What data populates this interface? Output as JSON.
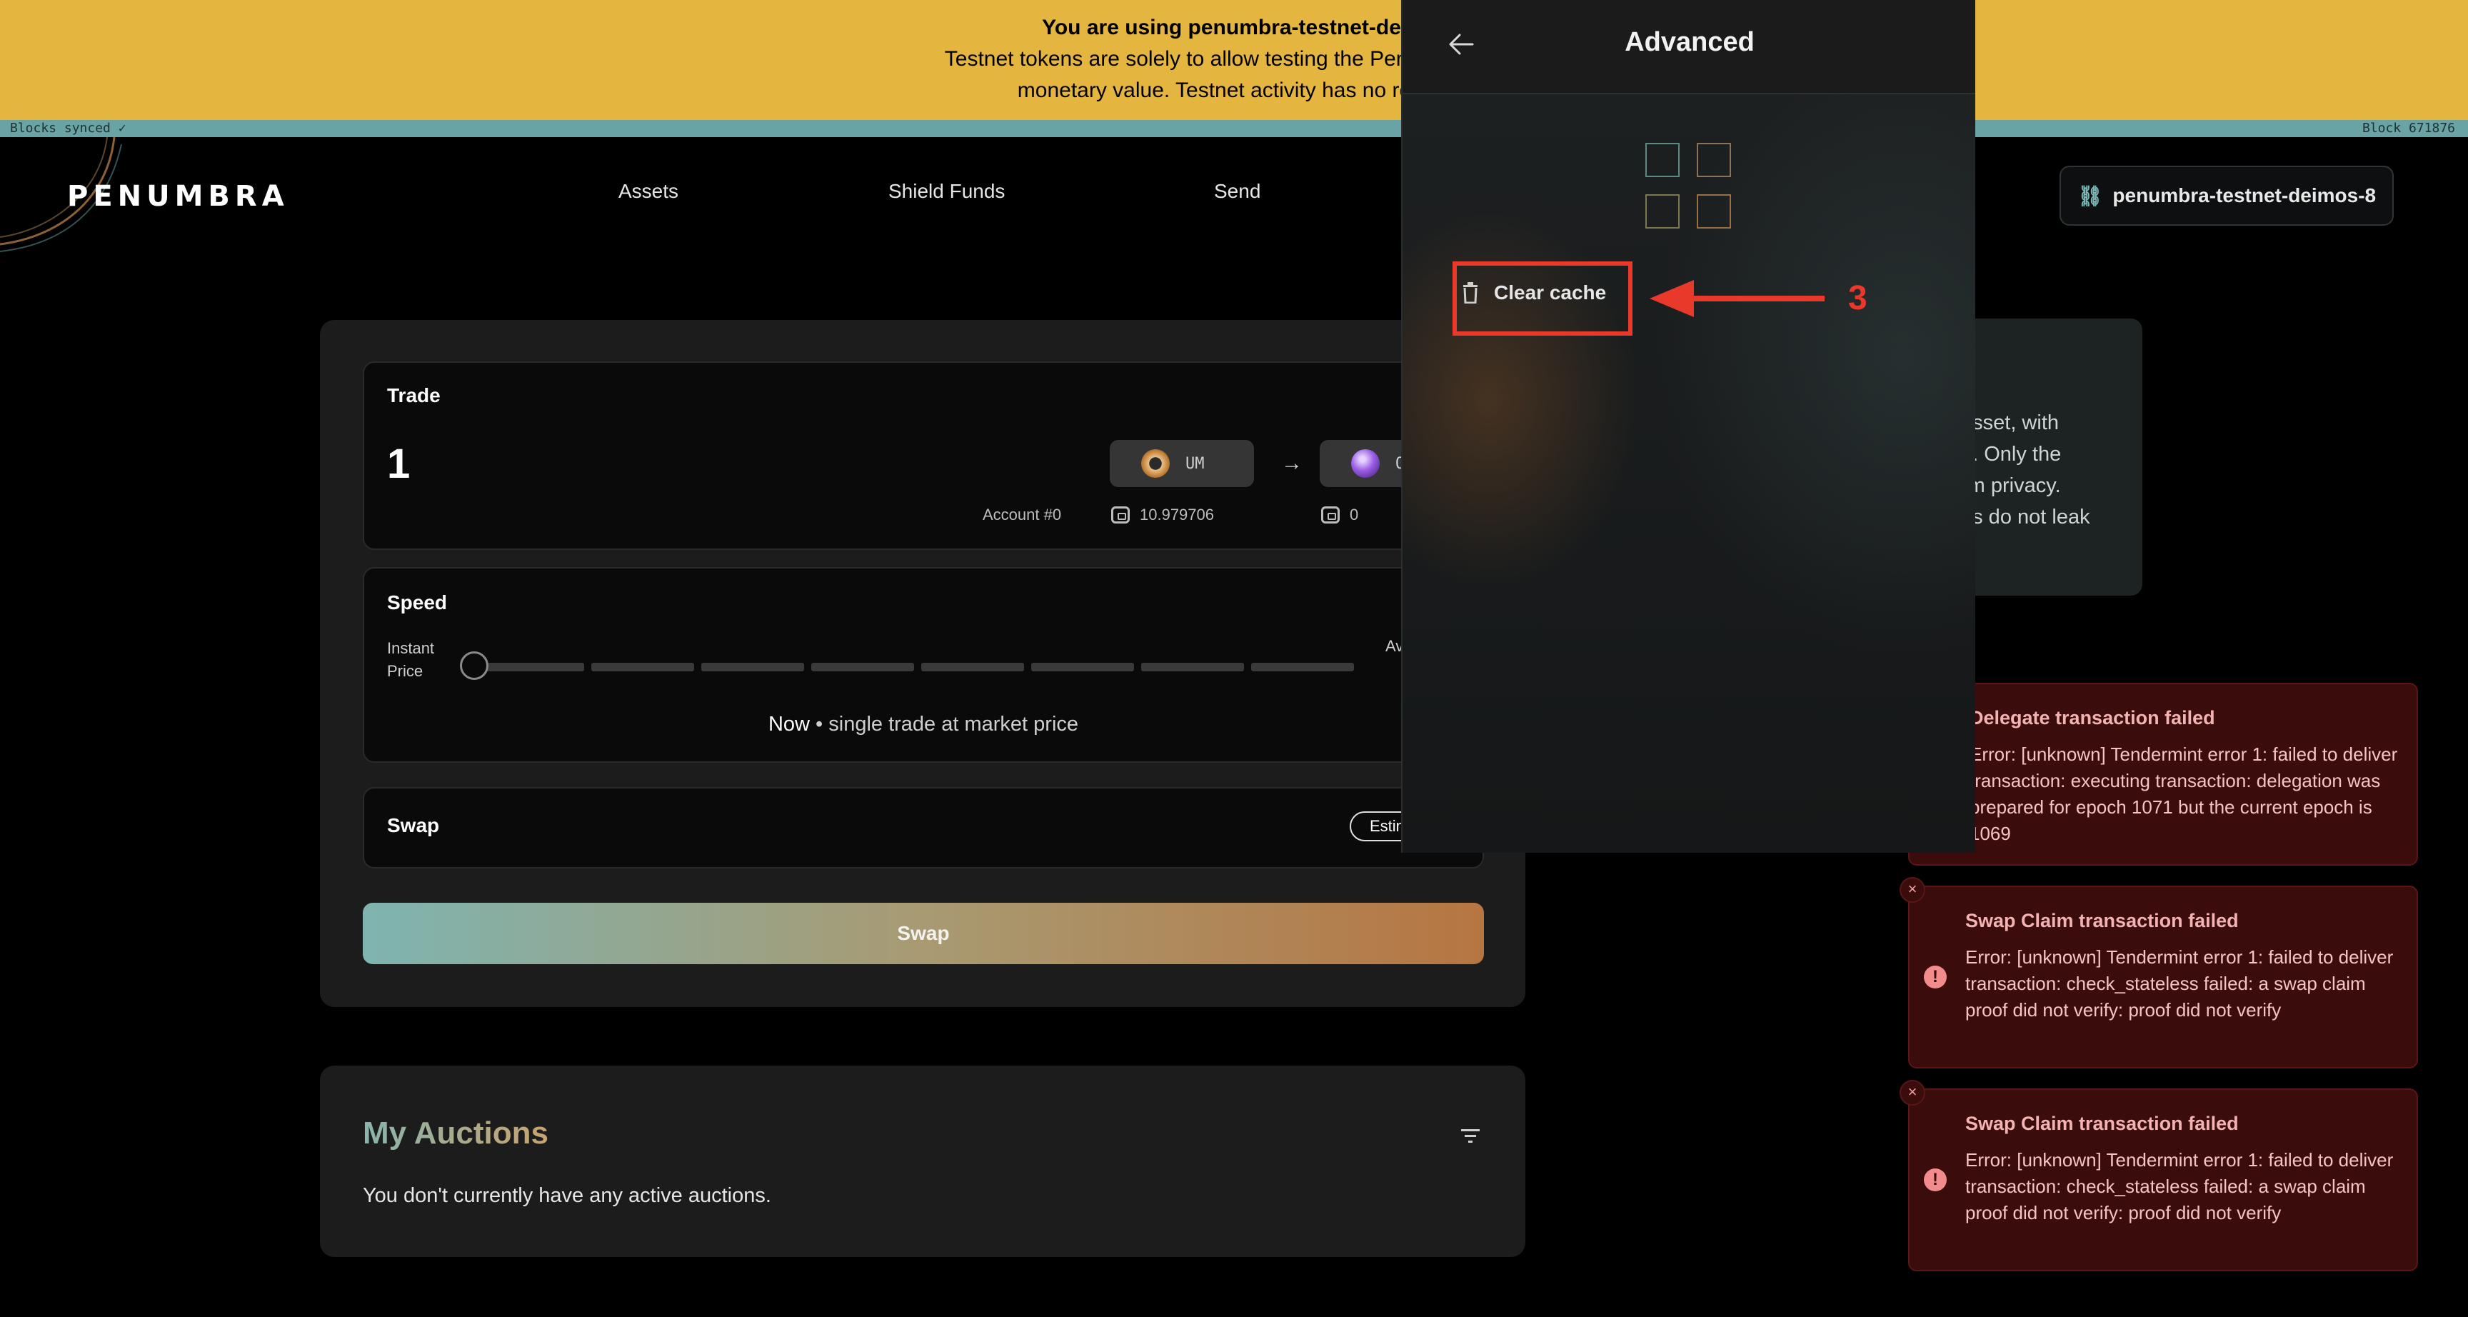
{
  "banner": {
    "line1": "You are using penumbra-testnet-deim",
    "line2": "Testnet tokens are solely to allow testing the Penumbra proto",
    "line3": "monetary value. Testnet activity has no relatio"
  },
  "sync": {
    "left": "Blocks synced ✓",
    "right": "Block 671876"
  },
  "header": {
    "logo": "PENUMBRA",
    "nav": [
      "Assets",
      "Shield Funds",
      "Send"
    ],
    "chain": "penumbra-testnet-deimos-8"
  },
  "trade": {
    "title": "Trade",
    "amount": "1",
    "from_token": "UM",
    "to_token": "OS",
    "account": "Account #0",
    "from_balance": "10.979706",
    "to_balance": "0"
  },
  "speed": {
    "title": "Speed",
    "left_label_1": "Instant",
    "left_label_2": "Price",
    "right_label": "Av",
    "desc_strong": "Now",
    "desc_rest": " • single trade at market price",
    "level": 0
  },
  "swap_panel": {
    "title": "Swap",
    "estimate_btn": "Estim"
  },
  "swap_button": "Swap",
  "auctions": {
    "title": "My Auctions",
    "empty": "You don't currently have any active auctions."
  },
  "info_card": {
    "text": "asset, with\ng. Only the\nrm privacy.\nns do not leak"
  },
  "toasts": [
    {
      "title": "Delegate transaction failed",
      "body": "Error: [unknown] Tendermint error 1: failed to deliver transaction: executing transaction: delegation was prepared for epoch 1071 but the current epoch is 1069"
    },
    {
      "title": "Swap Claim transaction failed",
      "body": "Error: [unknown] Tendermint error 1: failed to deliver transaction: check_stateless failed: a swap claim proof did not verify: proof did not verify"
    },
    {
      "title": "Swap Claim transaction failed",
      "body": "Error: [unknown] Tendermint error 1: failed to deliver transaction: check_stateless failed: a swap claim proof did not verify: proof did not verify"
    }
  ],
  "overlay": {
    "title": "Advanced",
    "clear_cache": "Clear cache"
  },
  "annotation": {
    "number": "3"
  },
  "colors": {
    "banner": "#e4b53f",
    "accent_red": "#e8392a",
    "toast_bg": "#3a0c0c"
  }
}
